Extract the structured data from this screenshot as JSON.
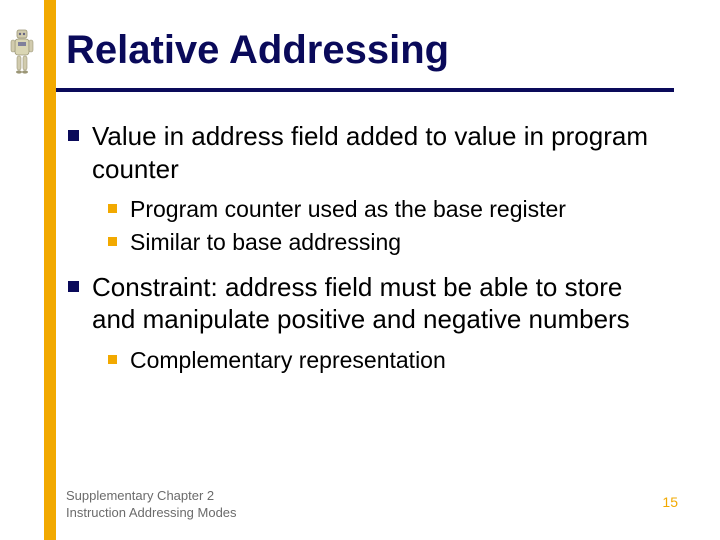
{
  "slide": {
    "title": "Relative Addressing",
    "bullets": [
      {
        "text": "Value in address field added to value in program counter",
        "children": [
          {
            "text": "Program counter used as the base register"
          },
          {
            "text": "Similar to base addressing"
          }
        ]
      },
      {
        "text": "Constraint: address field must be able to store and manipulate positive and negative numbers",
        "children": [
          {
            "text": "Complementary representation"
          }
        ]
      }
    ],
    "footer": {
      "line1": "Supplementary Chapter 2",
      "line2": "Instruction Addressing Modes",
      "page_number": "15"
    }
  }
}
